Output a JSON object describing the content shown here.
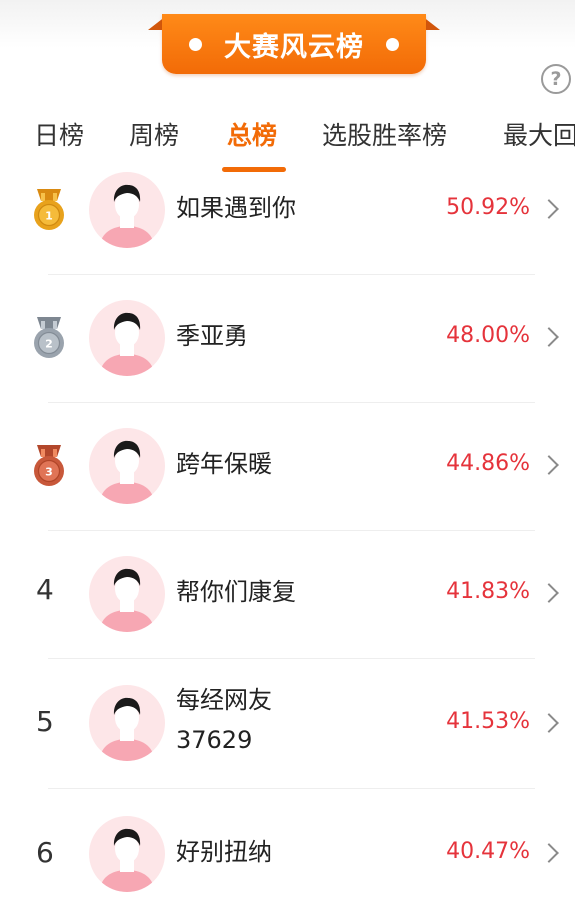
{
  "banner": {
    "title": "大赛风云榜"
  },
  "help": {
    "icon": "help-icon",
    "glyph": "?"
  },
  "tabs": [
    {
      "label": "日榜",
      "active": false
    },
    {
      "label": "周榜",
      "active": false
    },
    {
      "label": "总榜",
      "active": true
    },
    {
      "label": "选股胜率榜",
      "active": false
    },
    {
      "label": "最大回",
      "active": false
    }
  ],
  "colors": {
    "accent": "#f26b07",
    "rate": "#e5333b",
    "gold": "#e8a21c",
    "silver": "#9aa3ad",
    "bronze": "#c8583a"
  },
  "ranking": [
    {
      "rank": "1",
      "medal": "gold",
      "name": "如果遇到你",
      "name2": "",
      "rate": "50.92%"
    },
    {
      "rank": "2",
      "medal": "silver",
      "name": "季亚勇",
      "name2": "",
      "rate": "48.00%"
    },
    {
      "rank": "3",
      "medal": "bronze",
      "name": "跨年保暖",
      "name2": "",
      "rate": "44.86%"
    },
    {
      "rank": "4",
      "medal": "",
      "name": "帮你们康复",
      "name2": "",
      "rate": "41.83%"
    },
    {
      "rank": "5",
      "medal": "",
      "name": "每经网友",
      "name2": "37629",
      "rate": "41.53%"
    },
    {
      "rank": "6",
      "medal": "",
      "name": "好别扭纳",
      "name2": "",
      "rate": "40.47%"
    }
  ]
}
